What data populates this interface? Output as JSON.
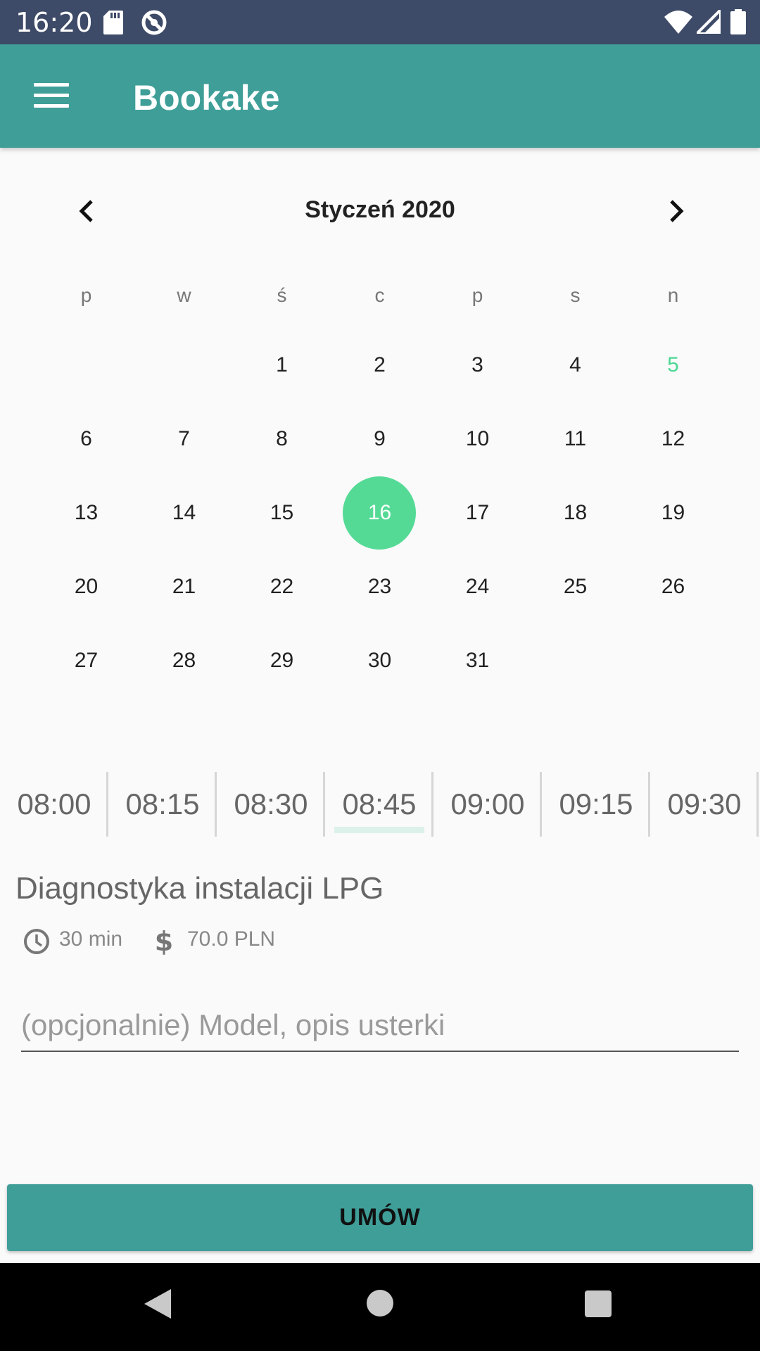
{
  "status_bar": {
    "time": "16:20",
    "icons": [
      "sd-card-icon",
      "sync-icon",
      "wifi-icon",
      "signal-icon",
      "battery-icon"
    ]
  },
  "app_bar": {
    "title": "Bookake",
    "menu_icon": "hamburger-menu-icon",
    "color": "#3f9e98"
  },
  "calendar": {
    "month_label": "Styczeń 2020",
    "prev_icon": "chevron-left-icon",
    "next_icon": "chevron-right-icon",
    "weekdays": [
      "p",
      "w",
      "ś",
      "c",
      "p",
      "s",
      "n"
    ],
    "weeks": [
      [
        "",
        "",
        "1",
        "2",
        "3",
        "4",
        "5"
      ],
      [
        "6",
        "7",
        "8",
        "9",
        "10",
        "11",
        "12"
      ],
      [
        "13",
        "14",
        "15",
        "16",
        "17",
        "18",
        "19"
      ],
      [
        "20",
        "21",
        "22",
        "23",
        "24",
        "25",
        "26"
      ],
      [
        "27",
        "28",
        "29",
        "30",
        "31",
        "",
        ""
      ]
    ],
    "selected_day": "16",
    "highlighted_day": "5",
    "selected_color": "#55da96"
  },
  "time_slots": {
    "items": [
      "08:00",
      "08:15",
      "08:30",
      "08:45",
      "09:00",
      "09:15",
      "09:30"
    ],
    "selected": "08:45"
  },
  "service": {
    "name": "Diagnostyka instalacji LPG",
    "duration": "30 min",
    "price": "70.0 PLN",
    "duration_icon": "clock-icon",
    "price_icon": "dollar-icon"
  },
  "note_field": {
    "value": "",
    "placeholder": "(opcjonalnie) Model, opis usterki"
  },
  "book_button": {
    "label": "UMÓW"
  },
  "nav_bar": {
    "icons": [
      "back-icon",
      "home-icon",
      "recents-icon"
    ]
  }
}
